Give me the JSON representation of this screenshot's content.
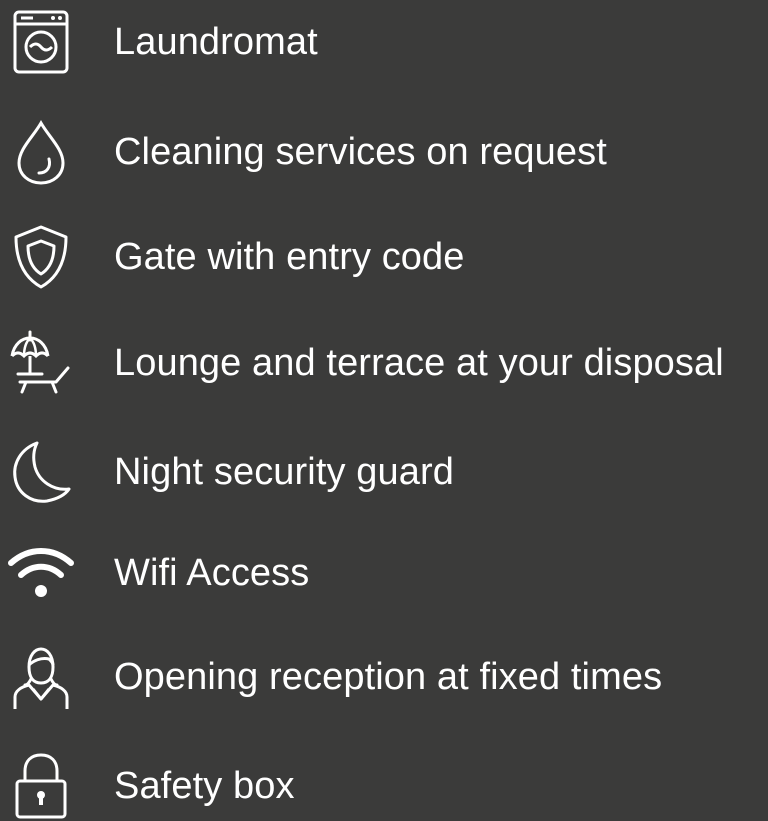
{
  "amenities": {
    "items": [
      {
        "icon": "washing-machine-icon",
        "label": "Laundromat"
      },
      {
        "icon": "water-drop-icon",
        "label": "Cleaning services on request"
      },
      {
        "icon": "shield-icon",
        "label": "Gate with entry code"
      },
      {
        "icon": "beach-umbrella-lounger-icon",
        "label": "Lounge and terrace at your disposal"
      },
      {
        "icon": "crescent-moon-icon",
        "label": "Night security guard"
      },
      {
        "icon": "wifi-icon",
        "label": "Wifi Access"
      },
      {
        "icon": "receptionist-icon",
        "label": "Opening reception at fixed times"
      },
      {
        "icon": "padlock-icon",
        "label": "Safety box"
      }
    ]
  },
  "colors": {
    "background": "#3b3b3a",
    "text": "#ffffff",
    "icon": "#ffffff"
  }
}
